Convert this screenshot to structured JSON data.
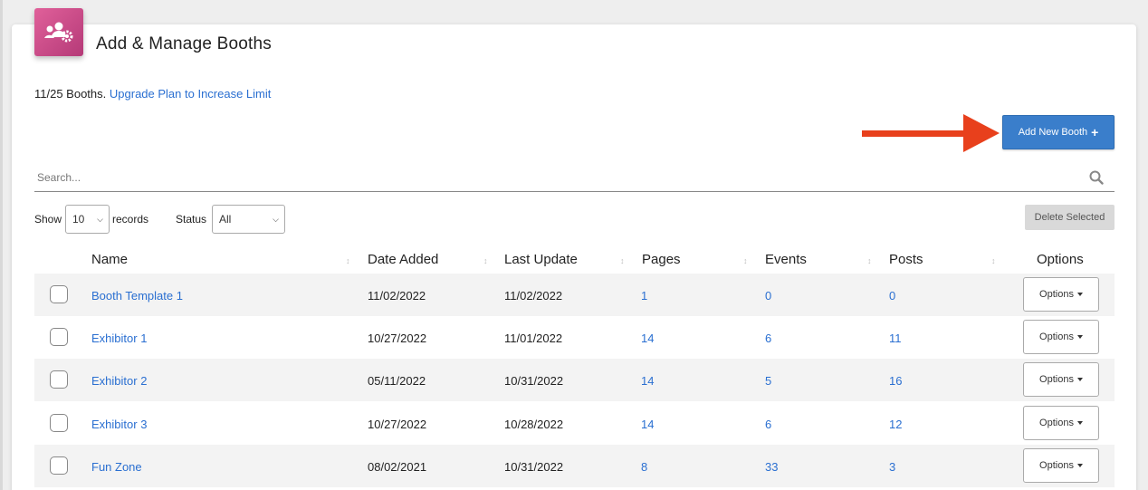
{
  "header": {
    "title": "Add & Manage Booths",
    "icon": "users-gear-icon"
  },
  "limit": {
    "text": "11/25 Booths.",
    "upgrade_link": "Upgrade Plan to Increase Limit"
  },
  "toolbar": {
    "add_label": "Add New Booth",
    "add_plus": "+",
    "delete_label": "Delete Selected"
  },
  "search": {
    "placeholder": "Search..."
  },
  "filters": {
    "show_label": "Show",
    "show_value": "10",
    "records_label": "records",
    "status_label": "Status",
    "status_value": "All"
  },
  "table": {
    "columns": [
      "Name",
      "Date Added",
      "Last Update",
      "Pages",
      "Events",
      "Posts",
      "Options"
    ],
    "options_label": "Options",
    "rows": [
      {
        "name": "Booth Template 1",
        "date_added": "11/02/2022",
        "last_update": "11/02/2022",
        "pages": "1",
        "events": "0",
        "posts": "0"
      },
      {
        "name": "Exhibitor 1",
        "date_added": "10/27/2022",
        "last_update": "11/01/2022",
        "pages": "14",
        "events": "6",
        "posts": "11"
      },
      {
        "name": "Exhibitor 2",
        "date_added": "05/11/2022",
        "last_update": "10/31/2022",
        "pages": "14",
        "events": "5",
        "posts": "16"
      },
      {
        "name": "Exhibitor 3",
        "date_added": "10/27/2022",
        "last_update": "10/28/2022",
        "pages": "14",
        "events": "6",
        "posts": "12"
      },
      {
        "name": "Fun Zone",
        "date_added": "08/02/2021",
        "last_update": "10/31/2022",
        "pages": "8",
        "events": "33",
        "posts": "3"
      }
    ]
  },
  "colors": {
    "accent": "#3a7ecb",
    "link": "#2a6fd1",
    "icon_bg": "#d04a8a",
    "arrow": "#e8401c"
  }
}
